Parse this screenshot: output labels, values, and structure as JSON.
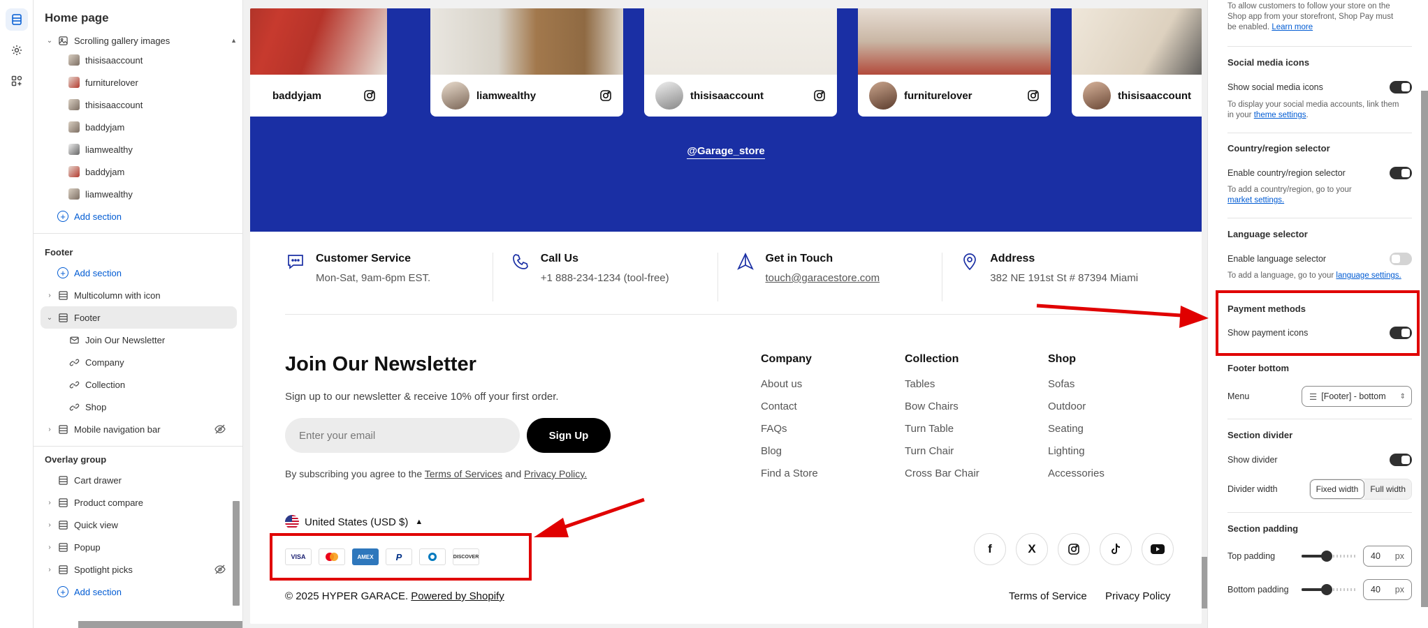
{
  "sidebar": {
    "title": "Home page",
    "tree": [
      {
        "label": "Scrolling gallery images",
        "type": "group"
      },
      {
        "label": "thisisaaccount"
      },
      {
        "label": "furniturelover"
      },
      {
        "label": "thisisaaccount"
      },
      {
        "label": "baddyjam"
      },
      {
        "label": "liamwealthy"
      },
      {
        "label": "baddyjam"
      },
      {
        "label": "liamwealthy"
      }
    ],
    "add_section": "Add section",
    "footer_group": "Footer",
    "footer_items": {
      "multicolumn": "Multicolumn with icon",
      "footer": "Footer",
      "join": "Join Our Newsletter",
      "company": "Company",
      "collection": "Collection",
      "shop": "Shop",
      "mobile_nav": "Mobile navigation bar"
    },
    "overlay_group": "Overlay group",
    "overlay_items": {
      "cart": "Cart drawer",
      "compare": "Product compare",
      "quick": "Quick view",
      "popup": "Popup",
      "spotlight": "Spotlight picks"
    }
  },
  "preview": {
    "gallery": [
      {
        "user": "baddyjam"
      },
      {
        "user": "liamwealthy"
      },
      {
        "user": "thisisaaccount"
      },
      {
        "user": "furniturelover"
      },
      {
        "user": "thisisaaccount"
      }
    ],
    "store_handle": "@Garage_store",
    "info": [
      {
        "title": "Customer Service",
        "detail": "Mon-Sat, 9am-6pm EST."
      },
      {
        "title": "Call Us",
        "detail": "+1 888-234-1234 (tool-free)"
      },
      {
        "title": "Get in Touch",
        "detail": "touch@garacestore.com"
      },
      {
        "title": "Address",
        "detail": "382 NE 191st St # 87394 Miami"
      }
    ],
    "newsletter": {
      "title": "Join Our Newsletter",
      "subtitle": "Sign up to our newsletter & receive 10% off your first order.",
      "placeholder": "Enter your email",
      "button": "Sign Up",
      "legal_prefix": "By subscribing you agree to the",
      "terms": "Terms of Services",
      "and": "and",
      "privacy": "Privacy Policy."
    },
    "columns": [
      {
        "heading": "Company",
        "links": [
          "About us",
          "Contact",
          "FAQs",
          "Blog",
          "Find a Store"
        ]
      },
      {
        "heading": "Collection",
        "links": [
          "Tables",
          "Bow Chairs",
          "Turn Table",
          "Turn Chair",
          "Cross Bar Chair"
        ]
      },
      {
        "heading": "Shop",
        "links": [
          "Sofas",
          "Outdoor",
          "Seating",
          "Lighting",
          "Accessories"
        ]
      }
    ],
    "currency": "United States (USD $)",
    "payment_icons": [
      "VISA",
      "Mastercard",
      "AMEX",
      "PayPal",
      "Diners",
      "DISCOVER"
    ],
    "social": [
      "f",
      "X",
      "instagram",
      "tiktok",
      "youtube"
    ],
    "copyright": "© 2025 HYPER GARACE.",
    "powered": "Powered by Shopify",
    "terms_of_service": "Terms of Service",
    "privacy_policy": "Privacy Policy"
  },
  "panel": {
    "follow_text": "To allow customers to follow your store on the Shop app from your storefront, Shop Pay must be enabled.",
    "learn_more": "Learn more",
    "social": {
      "heading": "Social media icons",
      "label": "Show social media icons",
      "help_prefix": "To display your social media accounts, link them in your",
      "help_link": "theme settings",
      "help_suffix": "."
    },
    "country": {
      "heading": "Country/region selector",
      "label": "Enable country/region selector",
      "help_prefix": "To add a country/region, go to your",
      "help_link": "market settings."
    },
    "language": {
      "heading": "Language selector",
      "label": "Enable language selector",
      "help_prefix": "To add a language, go to your",
      "help_link": "language settings."
    },
    "payment": {
      "heading": "Payment methods",
      "label": "Show payment icons"
    },
    "footer_bottom": {
      "heading": "Footer bottom",
      "menu_label": "Menu",
      "menu_value": "[Footer] - bottom"
    },
    "divider": {
      "heading": "Section divider",
      "show_label": "Show divider",
      "width_label": "Divider width",
      "opt_fixed": "Fixed width",
      "opt_full": "Full width"
    },
    "padding": {
      "heading": "Section padding",
      "top_label": "Top padding",
      "top_value": "40",
      "bottom_label": "Bottom padding",
      "bottom_value": "40",
      "unit": "px"
    }
  },
  "colors": {
    "accent": "#005bd3",
    "preview_blue": "#1a2fa4",
    "annotation_red": "#e00000"
  }
}
